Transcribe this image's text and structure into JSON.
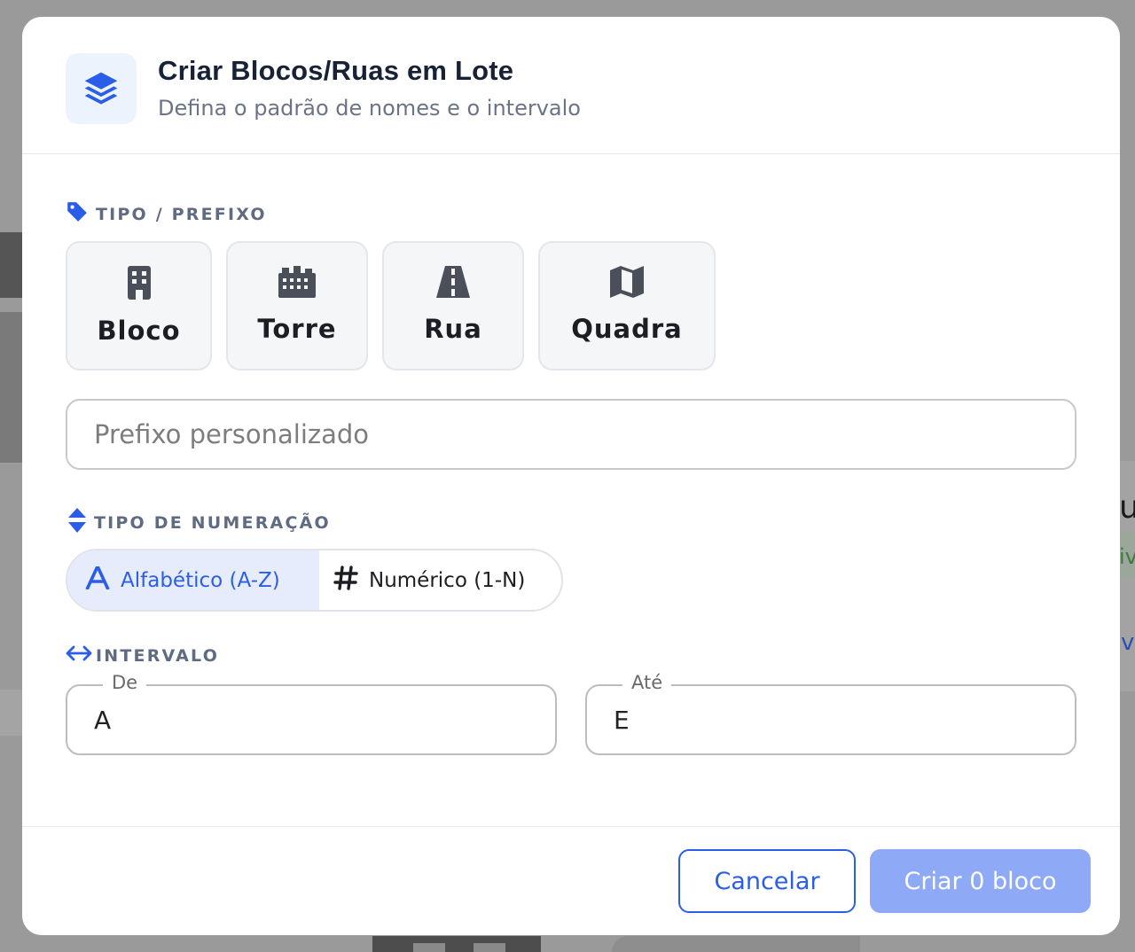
{
  "dialog": {
    "title": "Criar Blocos/Ruas em Lote",
    "subtitle": "Defina o padrão de nomes e o intervalo"
  },
  "prefix_section": {
    "label": "TIPO / PREFIXO",
    "options": [
      {
        "label": "Bloco",
        "icon": "building-icon"
      },
      {
        "label": "Torre",
        "icon": "city-icon"
      },
      {
        "label": "Rua",
        "icon": "road-icon"
      },
      {
        "label": "Quadra",
        "icon": "map-icon"
      }
    ],
    "custom_placeholder": "Prefixo personalizado",
    "custom_value": ""
  },
  "numbering_section": {
    "label": "TIPO DE NUMERAÇÃO",
    "options": [
      {
        "label": "Alfabético (A-Z)",
        "icon": "letter-a-icon",
        "selected": true
      },
      {
        "label": "Numérico (1-N)",
        "icon": "hashtag-icon",
        "selected": false
      }
    ]
  },
  "interval_section": {
    "label": "INTERVALO",
    "from": {
      "label": "De",
      "value": "A"
    },
    "to": {
      "label": "Até",
      "value": "E"
    }
  },
  "actions": {
    "cancel_label": "Cancelar",
    "create_label": "Criar 0 bloco"
  },
  "background": {
    "fragment_text_1": "u",
    "fragment_text_2": "iv",
    "fragment_text_3": "v"
  },
  "colors": {
    "accent": "#2b5ee8",
    "accent_disabled": "#8eaaf6",
    "selected_bg": "#e6ecfb",
    "label_gray": "#5f6b80",
    "title": "#182237"
  }
}
